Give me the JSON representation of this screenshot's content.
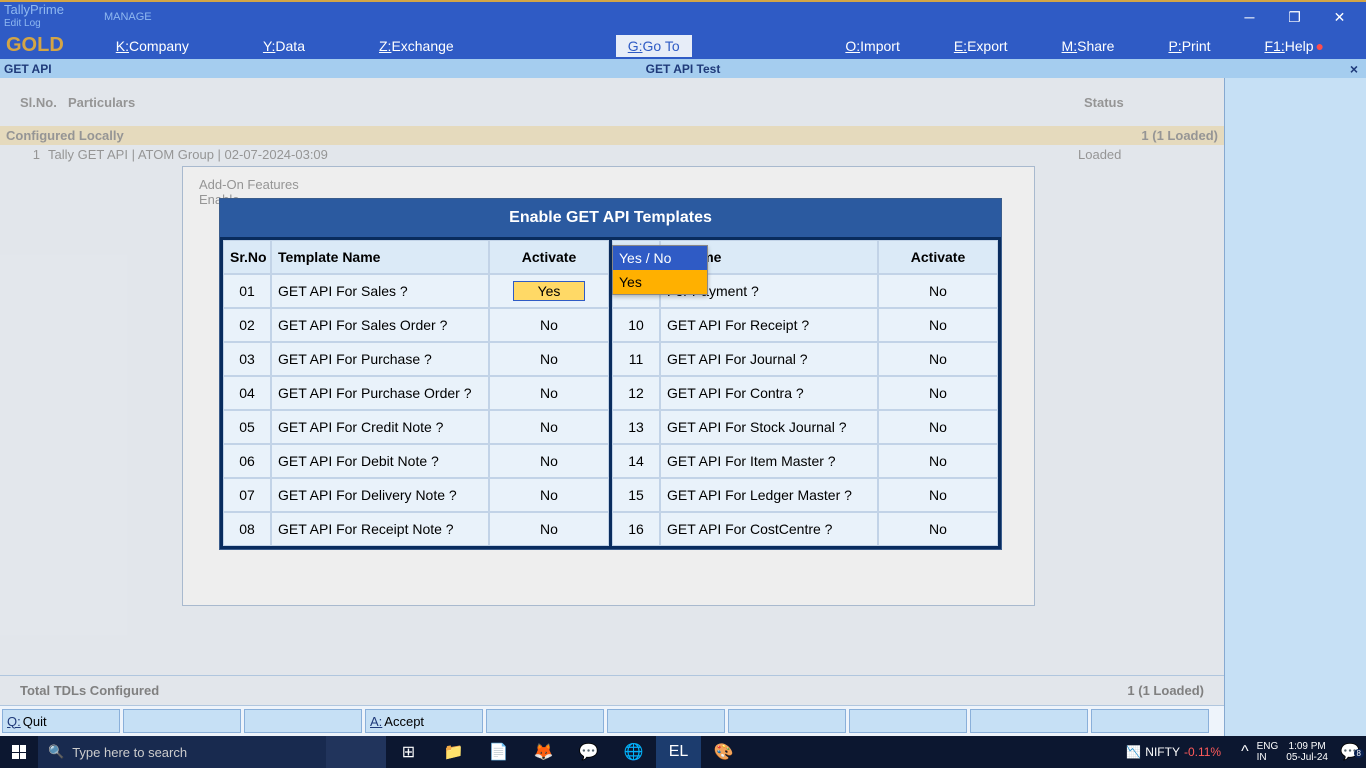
{
  "title": {
    "product": "TallyPrime",
    "editlog": "Edit Log",
    "manage": "MANAGE",
    "gold": "GOLD"
  },
  "menu": {
    "company": "Company",
    "company_key": "K:",
    "data": "Data",
    "data_key": "Y:",
    "exchange": "Exchange",
    "exchange_key": "Z:",
    "goto": "Go To",
    "goto_key": "G:",
    "import": "Import",
    "import_key": "O:",
    "export": "Export",
    "export_key": "E:",
    "share": "Share",
    "share_key": "M:",
    "print": "Print",
    "print_key": "P:",
    "help": "Help",
    "help_key": "F1:"
  },
  "tabs": {
    "left": "GET API",
    "center": "GET API Test",
    "close": "×"
  },
  "table": {
    "slno": "Sl.No.",
    "particulars": "Particulars",
    "status": "Status",
    "configured": "Configured Locally",
    "configured_summary": "1 (1 Loaded)",
    "row1_idx": "1",
    "row1_name": "Tally GET API  | ATOM Group | 02-07-2024-03:09",
    "row1_status": "Loaded",
    "inline1": "Add-On Features",
    "inline2": "Enable",
    "total_label": "Total TDLs Configured",
    "total_val": "1 (1 Loaded)"
  },
  "btns": {
    "quit_key": "Q:",
    "quit": "Quit",
    "accept_key": "A:",
    "accept": "Accept"
  },
  "modal": {
    "title": "Enable GET API Templates",
    "headers": {
      "sr": "Sr.No",
      "name": "Template Name",
      "activate": "Activate"
    },
    "left": [
      {
        "sr": "01",
        "name": "GET API For Sales ?",
        "val": "Yes",
        "selected": true
      },
      {
        "sr": "02",
        "name": "GET API For Sales Order ?",
        "val": "No"
      },
      {
        "sr": "03",
        "name": "GET API For Purchase ?",
        "val": "No"
      },
      {
        "sr": "04",
        "name": "GET API For Purchase Order ?",
        "val": "No"
      },
      {
        "sr": "05",
        "name": "GET API For Credit Note ?",
        "val": "No"
      },
      {
        "sr": "06",
        "name": "GET API For Debit Note ?",
        "val": "No"
      },
      {
        "sr": "07",
        "name": "GET API For Delivery Note ?",
        "val": "No"
      },
      {
        "sr": "08",
        "name": "GET API For Receipt Note ?",
        "val": "No"
      }
    ],
    "right_name_partial": "te Name",
    "right": [
      {
        "sr": "",
        "name": "For Payment ?",
        "val": "No"
      },
      {
        "sr": "10",
        "name": "GET API For Receipt ?",
        "val": "No"
      },
      {
        "sr": "11",
        "name": "GET API For Journal ?",
        "val": "No"
      },
      {
        "sr": "12",
        "name": "GET API For Contra ?",
        "val": "No"
      },
      {
        "sr": "13",
        "name": "GET API For Stock Journal ?",
        "val": "No"
      },
      {
        "sr": "14",
        "name": "GET API For Item Master ?",
        "val": "No"
      },
      {
        "sr": "15",
        "name": "GET API For Ledger Master ?",
        "val": "No"
      },
      {
        "sr": "16",
        "name": "GET API For CostCentre ?",
        "val": "No"
      }
    ]
  },
  "dropdown": {
    "title": "Yes / No",
    "option": "Yes"
  },
  "taskbar": {
    "search_placeholder": "Type here to search",
    "stock_name": "NIFTY",
    "stock_change": "-0.11%",
    "lang1": "ENG",
    "lang2": "IN",
    "time": "1:09 PM",
    "date": "05-Jul-24",
    "notif_count": "8"
  }
}
